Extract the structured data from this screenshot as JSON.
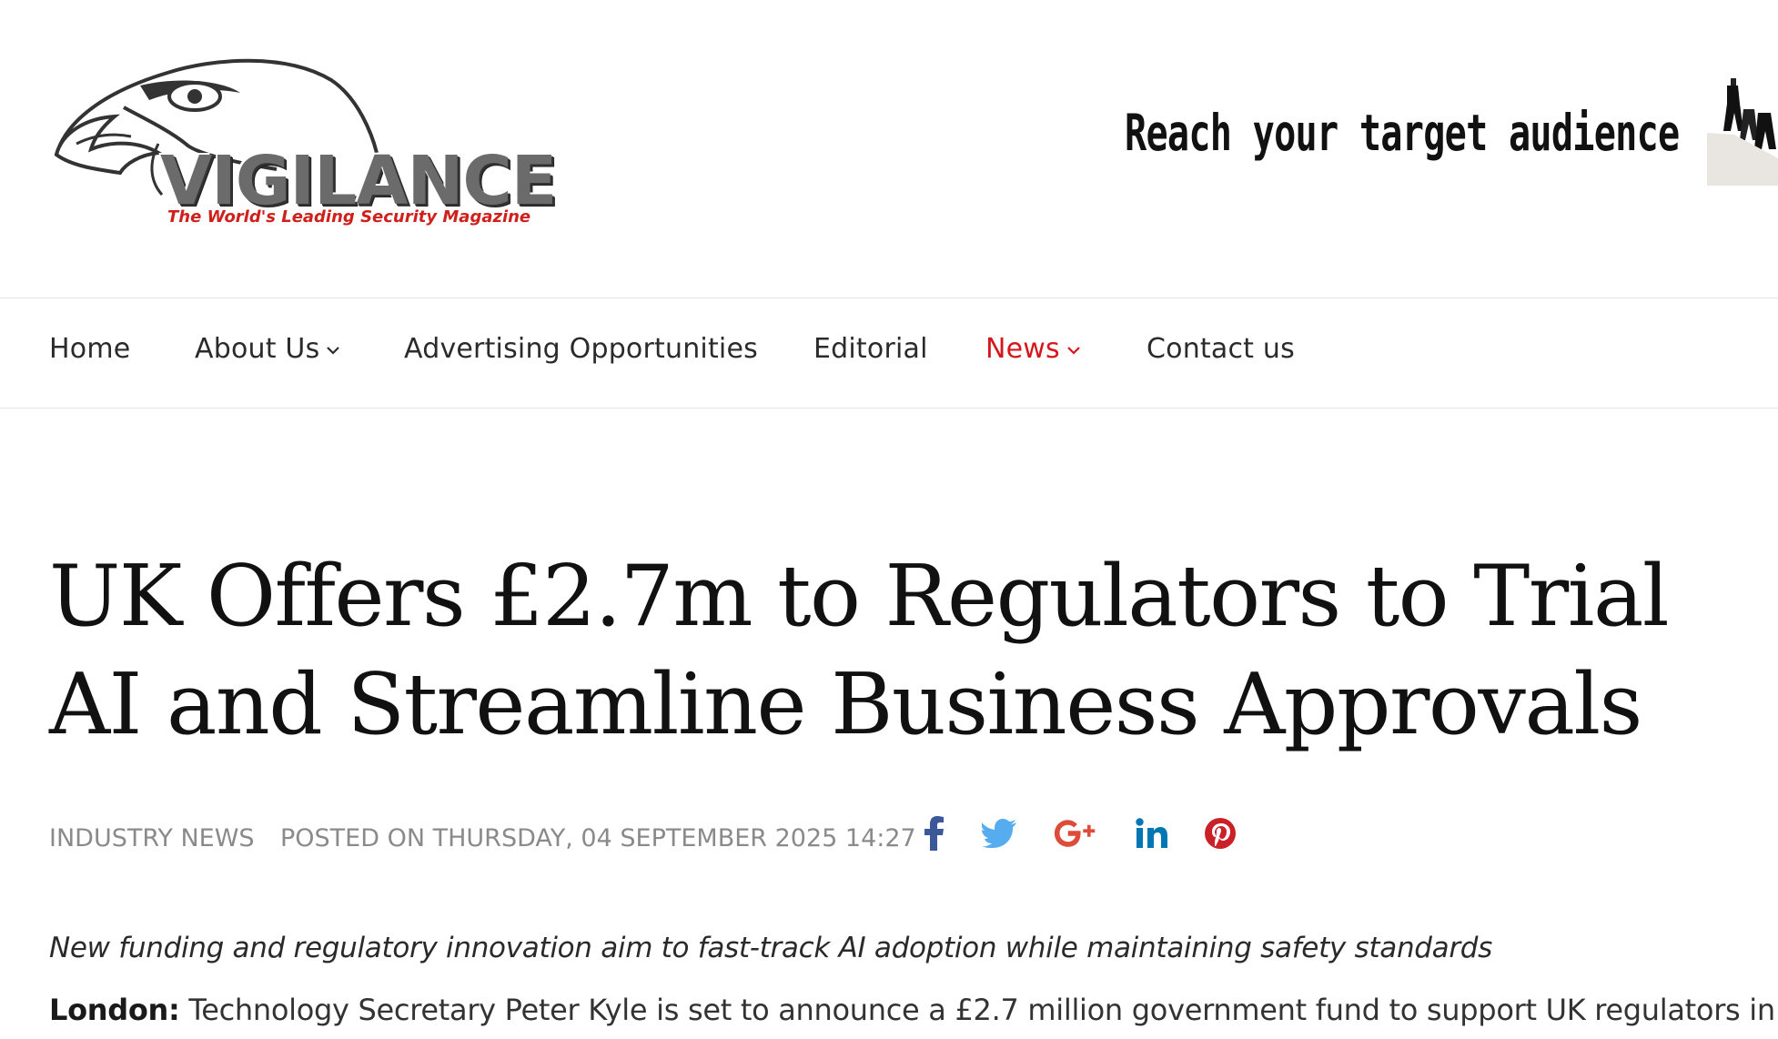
{
  "logo": {
    "word": "VIGILANCE",
    "tagline": "The World's Leading Security Magazine"
  },
  "banner": {
    "text": "Reach your target audience"
  },
  "nav": {
    "home": "Home",
    "about": "About Us",
    "advertising": "Advertising Opportunities",
    "editorial": "Editorial",
    "news": "News",
    "contact": "Contact us"
  },
  "article": {
    "title": "UK Offers £2.7m to Regulators to Trial AI and Streamline Business Approvals",
    "category": "INDUSTRY NEWS",
    "posted": "POSTED ON THURSDAY, 04 SEPTEMBER 2025 14:27",
    "subtitle": "New funding and regulatory innovation aim to fast-track AI adoption while maintaining safety standards",
    "lead_label": "London:",
    "lead_text": " Technology Secretary Peter Kyle is set to announce a £2.7 million government fund to support UK regulators in"
  },
  "share": {
    "icons": [
      "facebook-icon",
      "twitter-icon",
      "google-plus-icon",
      "linkedin-icon",
      "pinterest-icon"
    ]
  },
  "colors": {
    "accent": "#d6161d",
    "facebook": "#3b5998",
    "twitter": "#55acee",
    "google_plus": "#dd4b39",
    "linkedin": "#0077b5",
    "pinterest": "#cb2027",
    "meta": "#8a8a8a"
  }
}
